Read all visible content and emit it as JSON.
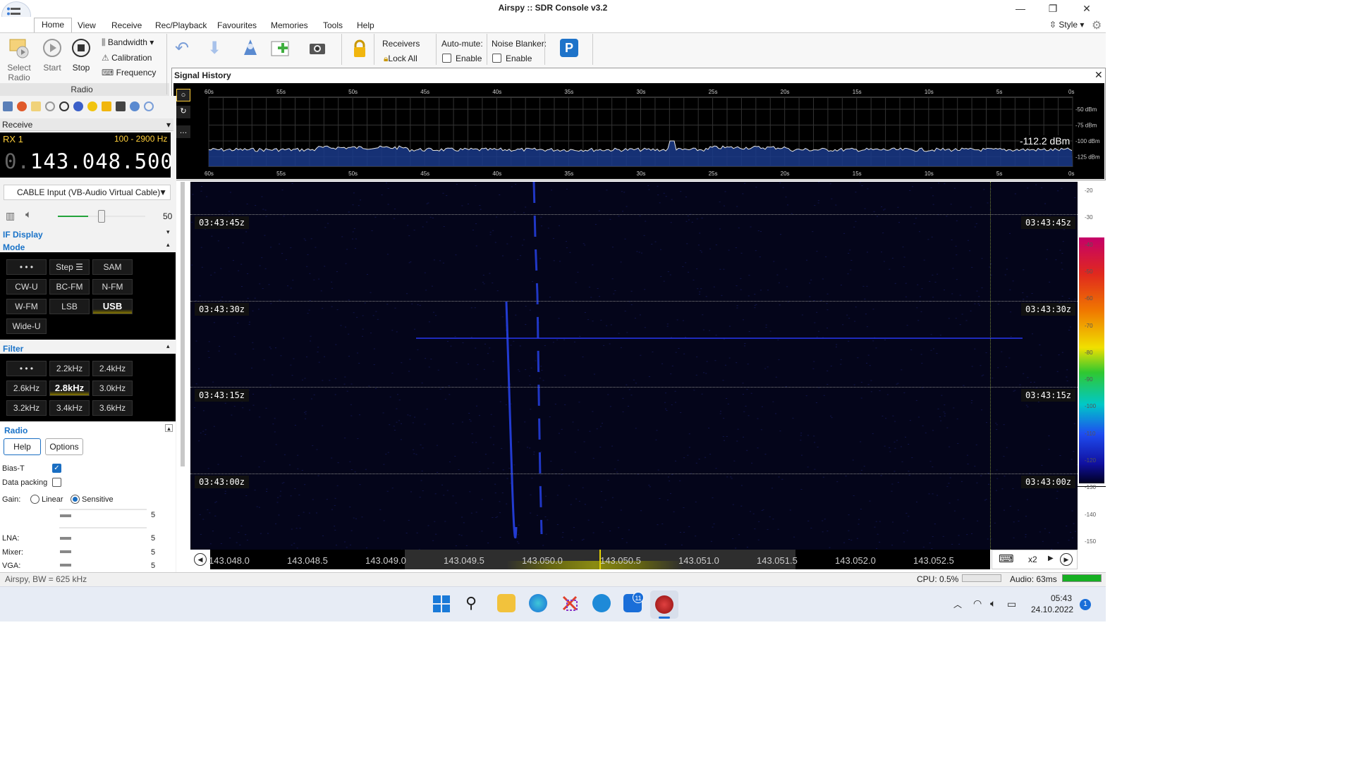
{
  "window": {
    "title": "Airspy :: SDR Console v3.2",
    "minimize": "—",
    "restore": "❐",
    "close": "✕"
  },
  "ribbon": {
    "tabs": [
      "Home",
      "View",
      "Receive",
      "Rec/Playback",
      "Favourites",
      "Memories",
      "Tools",
      "Help"
    ],
    "style_label": "Style",
    "select_radio_1": "Select",
    "select_radio_2": "Radio",
    "start": "Start",
    "stop": "Stop",
    "bandwidth": "Bandwidth",
    "calibration": "Calibration",
    "frequency": "Frequency",
    "group_radio": "Radio",
    "receivers": "Receivers",
    "lock_all": "Lock All",
    "auto_mute": "Auto-mute:",
    "auto_mute_enable": "Enable",
    "noise_blanker": "Noise Blanker:",
    "noise_blanker_enable": "Enable"
  },
  "signal_history": {
    "title": "Signal History",
    "reading": "-112.2 dBm",
    "time_ticks": [
      "60s",
      "55s",
      "50s",
      "45s",
      "40s",
      "35s",
      "30s",
      "25s",
      "20s",
      "15s",
      "10s",
      "5s",
      "0s"
    ],
    "dbm_ticks": [
      "-50 dBm",
      "-75 dBm",
      "-100 dBm",
      "-125 dBm"
    ]
  },
  "receive": {
    "header": "Receive",
    "rx": "RX 1",
    "bandwidth": "100 - 2900 Hz",
    "freq_prefix": "0.",
    "frequency": "143.048.500",
    "audio_device": "CABLE Input (VB-Audio Virtual Cable)",
    "volume": "50",
    "volume_level": 0.5
  },
  "if_display": {
    "label": "IF Display"
  },
  "mode": {
    "label": "Mode",
    "buttons": [
      "• • •",
      "Step ☰",
      "SAM",
      "CW-U",
      "BC-FM",
      "N-FM",
      "W-FM",
      "LSB",
      "USB",
      "Wide-U"
    ],
    "selected": "USB"
  },
  "filter": {
    "label": "Filter",
    "buttons": [
      "• • •",
      "2.2kHz",
      "2.4kHz",
      "2.6kHz",
      "2.8kHz",
      "3.0kHz",
      "3.2kHz",
      "3.4kHz",
      "3.6kHz"
    ],
    "selected": "2.8kHz"
  },
  "radio": {
    "label": "Radio",
    "help": "Help",
    "options": "Options",
    "bias_t": "Bias-T",
    "data_packing": "Data packing",
    "gain": "Gain:",
    "gain_linear": "Linear",
    "gain_sensitive": "Sensitive",
    "gain_value": "5",
    "lna": "LNA:",
    "lna_value": "5",
    "mixer": "Mixer:",
    "mixer_value": "5",
    "vga": "VGA:",
    "vga_value": "5"
  },
  "waterfall": {
    "timestamps": [
      "03:43:45z",
      "03:43:30z",
      "03:43:15z",
      "03:43:00z"
    ],
    "scale": [
      "-20",
      "-30",
      "-40",
      "-50",
      "-60",
      "-70",
      "-80",
      "-90",
      "-100",
      "-110",
      "-120",
      "-130",
      "-140",
      "-150"
    ]
  },
  "freq_axis": {
    "labels": [
      "143.048.0",
      "143.048.5",
      "143.049.0",
      "143.049.5",
      "143.050.0",
      "143.050.5",
      "143.051.0",
      "143.051.5",
      "143.052.0",
      "143.052.5"
    ],
    "zoom": "x2"
  },
  "status": {
    "left": "Airspy, BW = 625 kHz",
    "cpu": "CPU: 0.5%",
    "audio": "Audio: 63ms"
  },
  "taskbar": {
    "time": "05:43",
    "date": "24.10.2022",
    "mail_badge": "11",
    "notif_badge": "1"
  }
}
